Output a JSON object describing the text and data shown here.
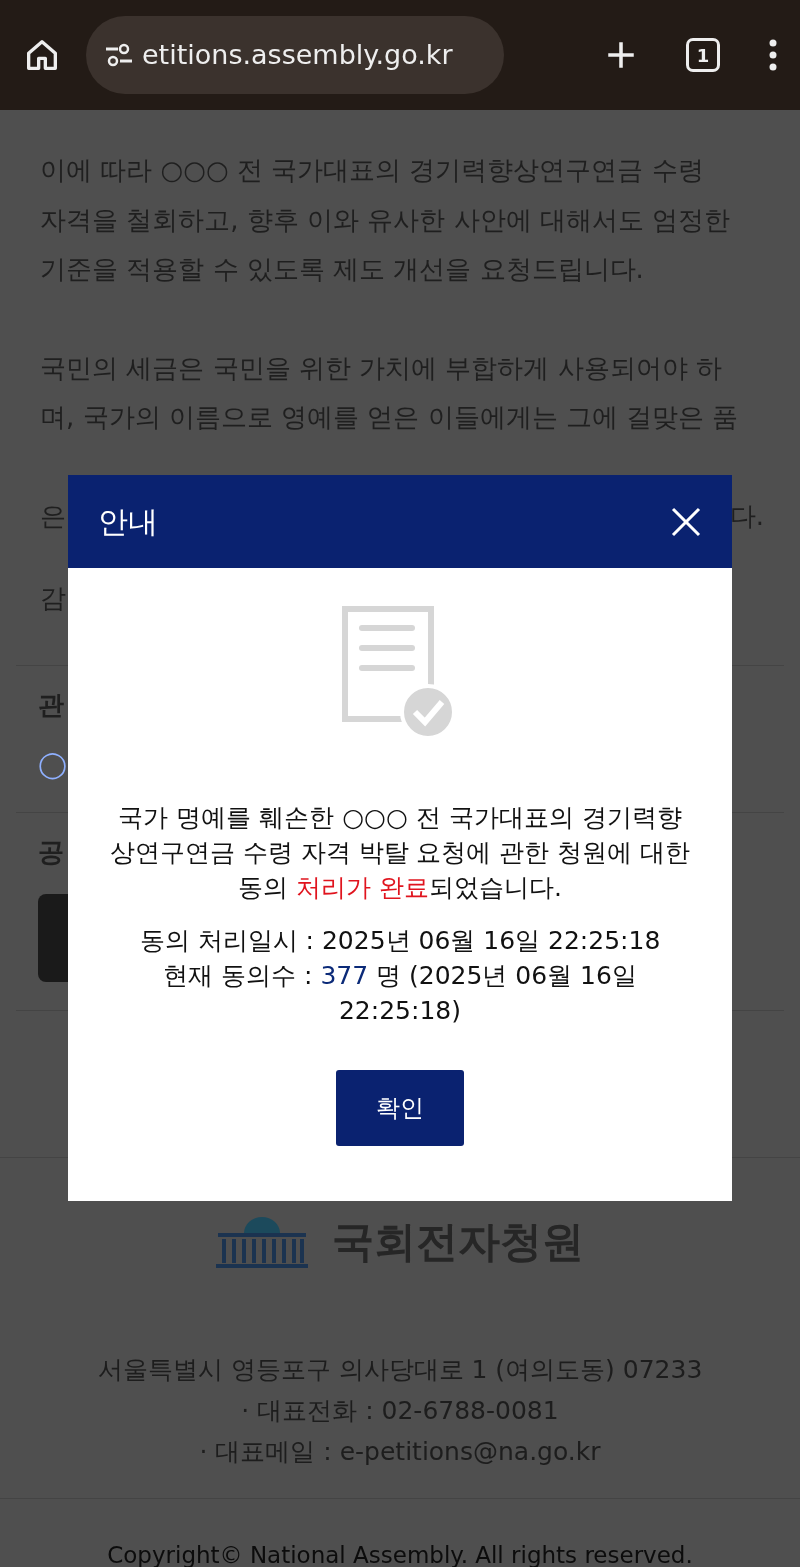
{
  "browser": {
    "url": "etitions.assembly.go.kr",
    "tab_count": "1"
  },
  "page": {
    "paragraph_1": [
      "이에 따라 ○○○ 전 국가대표의 경기력향상연구연금 수령",
      "자격을 철회하고, 향후 이와 유사한 사안에 대해서도 엄정한",
      "기준을 적용할 수 있도록 제도 개선을 요청드립니다."
    ],
    "paragraph_2": [
      "국민의 세금은 국민을 위한 가치에 부합하게 사용되어야 하",
      "며, 국가의 이름으로 영예를 얻은 이들에게는 그에 걸맞은 품"
    ],
    "line_start": "은",
    "line_end": "다.",
    "closing_start": "감",
    "sections": [
      {
        "heading": "관",
        "content": "◯",
        "kind": "link"
      },
      {
        "heading": "공",
        "kind": "share"
      }
    ]
  },
  "modal": {
    "title": "안내",
    "message": [
      {
        "text": "국가 명예를 훼손한 ○○○ 전 국가대표의 경기력향상연구연금 수령 자격 박탈 요청에 관한 청원에 대한 동의 ",
        "kind": "plain"
      },
      {
        "text": "처리가 완료",
        "kind": "alert"
      },
      {
        "text": "되었습니다.",
        "kind": "plain"
      }
    ],
    "date_line": "동의 처리일시 : 2025년 06월 16일 22:25:18",
    "count_line": [
      {
        "text": "현재 동의수 : ",
        "kind": "plain"
      },
      {
        "text": "377",
        "kind": "count"
      },
      {
        "text": " 명 (2025년 06월 16일 22:25:18)",
        "kind": "plain"
      }
    ],
    "confirm": "확인"
  },
  "footer": {
    "logo_text": "국회전자청원",
    "address": "서울특별시 영등포구 의사당대로 1 (여의도동) 07233",
    "phone": "· 대표전화 : 02-6788-0081",
    "email": "· 대표메일 : e-petitions@na.go.kr",
    "copyright": "Copyright© National Assembly. All rights reserved."
  }
}
